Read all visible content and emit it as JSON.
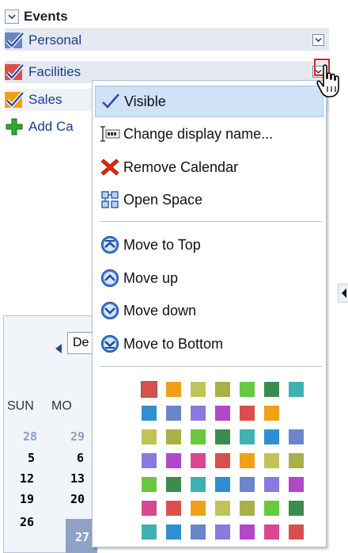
{
  "events": {
    "title": "Events",
    "calendars": [
      {
        "name": "Personal",
        "color": "#6a86c8"
      },
      {
        "name": "Facilities",
        "color": "#d8504c"
      },
      {
        "name": "Sales",
        "color": "#f0a018"
      }
    ],
    "add_label": "Add Ca"
  },
  "menu": {
    "items": [
      {
        "label": "Visible",
        "icon": "checkmark-icon"
      },
      {
        "label": "Change display name...",
        "icon": "rename-icon"
      },
      {
        "label": "Remove Calendar",
        "icon": "red-x-icon"
      },
      {
        "label": "Open Space",
        "icon": "open-space-icon"
      },
      {
        "label": "Move to Top",
        "icon": "move-to-top-icon"
      },
      {
        "label": "Move up",
        "icon": "move-up-icon"
      },
      {
        "label": "Move down",
        "icon": "move-down-icon"
      },
      {
        "label": "Move to Bottom",
        "icon": "move-to-bottom-icon"
      }
    ],
    "palette": [
      [
        "#d8504c",
        "#f0a018",
        "#c2c25a",
        "#a8b048",
        "#68c840",
        "#3c8c50",
        "#40b0b0"
      ],
      [
        "#2f8fd0",
        "#6a86c8",
        "#8a7ae0",
        "#b048c8",
        "#d8504c",
        "#f0a018"
      ],
      [
        "#c2c25a",
        "#a8b048",
        "#68c840",
        "#3c8c50",
        "#40b0b0",
        "#2f8fd0",
        "#6a86c8"
      ],
      [
        "#8a7ae0",
        "#b048c8",
        "#d84890",
        "#d8504c",
        "#f0a018",
        "#c2c25a",
        "#a8b048"
      ],
      [
        "#68c840",
        "#3c8c50",
        "#40b0b0",
        "#2f8fd0",
        "#6a86c8",
        "#8a7ae0",
        "#b048c8"
      ],
      [
        "#d84890",
        "#d8504c",
        "#f0a018",
        "#c2c25a",
        "#a8b048",
        "#68c840",
        "#3c8c50"
      ],
      [
        "#40b0b0",
        "#2f8fd0",
        "#6a86c8",
        "#8a7ae0",
        "#b048c8",
        "#d84890",
        "#d8504c"
      ]
    ]
  },
  "mini_calendar": {
    "month": "De",
    "day_headers": [
      "SUN",
      "MO"
    ],
    "rows": [
      [
        "28",
        "29"
      ],
      [
        "5",
        "6"
      ],
      [
        "12",
        "13"
      ],
      [
        "19",
        "20"
      ],
      [
        "26",
        "27"
      ]
    ]
  }
}
